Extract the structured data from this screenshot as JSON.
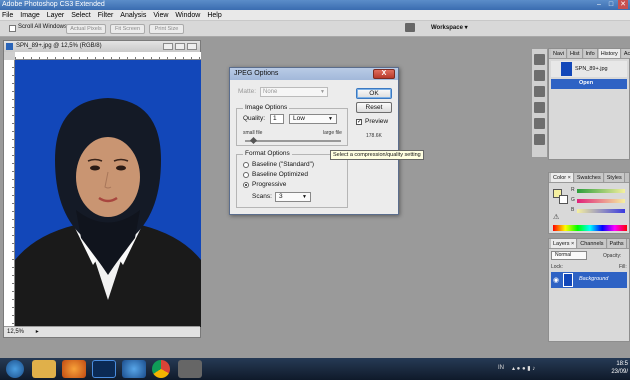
{
  "window_title": "Adobe Photoshop CS3 Extended",
  "menu": [
    "File",
    "Image",
    "Layer",
    "Select",
    "Filter",
    "Analysis",
    "View",
    "Window",
    "Help"
  ],
  "options_bar": {
    "scroll_all": "Scroll All Windows",
    "actual_pixels": "Actual Pixels",
    "fit_screen": "Fit Screen",
    "print_size": "Print Size",
    "workspace": "Workspace ▾"
  },
  "document": {
    "title": "SPN_89+.jpg @ 12,5% (RGB/8)",
    "zoom": "12,5%",
    "ruler_top": [
      "0",
      "10",
      "20",
      "30",
      "40",
      "50",
      "60",
      "70",
      "80",
      "90",
      "100",
      "110",
      "120",
      "130",
      "140",
      "150",
      "160",
      "170",
      "180",
      "190",
      "200",
      "21"
    ],
    "ruler_left": [
      "0",
      "1",
      "2",
      "3",
      "4",
      "5",
      "6",
      "7",
      "8",
      "9",
      "0",
      "1",
      "2",
      "3",
      "4",
      "5",
      "6",
      "7",
      "8",
      "9",
      "0",
      "1",
      "2",
      "3",
      "4",
      "5",
      "6"
    ]
  },
  "dialog": {
    "title": "JPEG Options",
    "close_label": "X",
    "matte_label": "Matte:",
    "matte_value": "None",
    "image_options_label": "Image Options",
    "quality_label": "Quality:",
    "quality_value": "1",
    "quality_preset": "Low",
    "small_file": "small file",
    "large_file": "large file",
    "quality_slider_fraction": 0.08,
    "format_options_label": "Format Options",
    "format_baseline_standard": "Baseline (\"Standard\")",
    "format_baseline_optimized": "Baseline Optimized",
    "format_progressive": "Progressive",
    "selected_format": "Progressive",
    "scans_label": "Scans:",
    "scans_value": "3",
    "ok_label": "OK",
    "reset_label": "Reset",
    "preview_label": "Preview",
    "preview_checked": true,
    "file_size": "178.6K"
  },
  "tooltip": "Select a compression/quality setting",
  "history_panel": {
    "tabs": [
      "Navi",
      "Hist",
      "Info",
      "History ×",
      "Acti"
    ],
    "snapshot": "SPN_89+.jpg",
    "state": "Open"
  },
  "color_panel": {
    "tabs": [
      "Color ×",
      "Swatches",
      "Styles"
    ],
    "channels": [
      "R",
      "G",
      "B"
    ],
    "values": [
      "",
      "",
      ""
    ],
    "foreground_color": "#f5f0a0"
  },
  "layers_panel": {
    "tabs": [
      "Layers ×",
      "Channels",
      "Paths"
    ],
    "blend_mode": "Normal",
    "opacity_label": "Opacity:",
    "lock_label": "Lock:",
    "fill_label": "Fill:",
    "layer_name": "Background"
  },
  "taskbar": {
    "lang": "IN",
    "time": "18:5",
    "date": "23/09/"
  },
  "colors": {
    "photo_bg": "#1247b9",
    "selection": "#2e62c4"
  }
}
